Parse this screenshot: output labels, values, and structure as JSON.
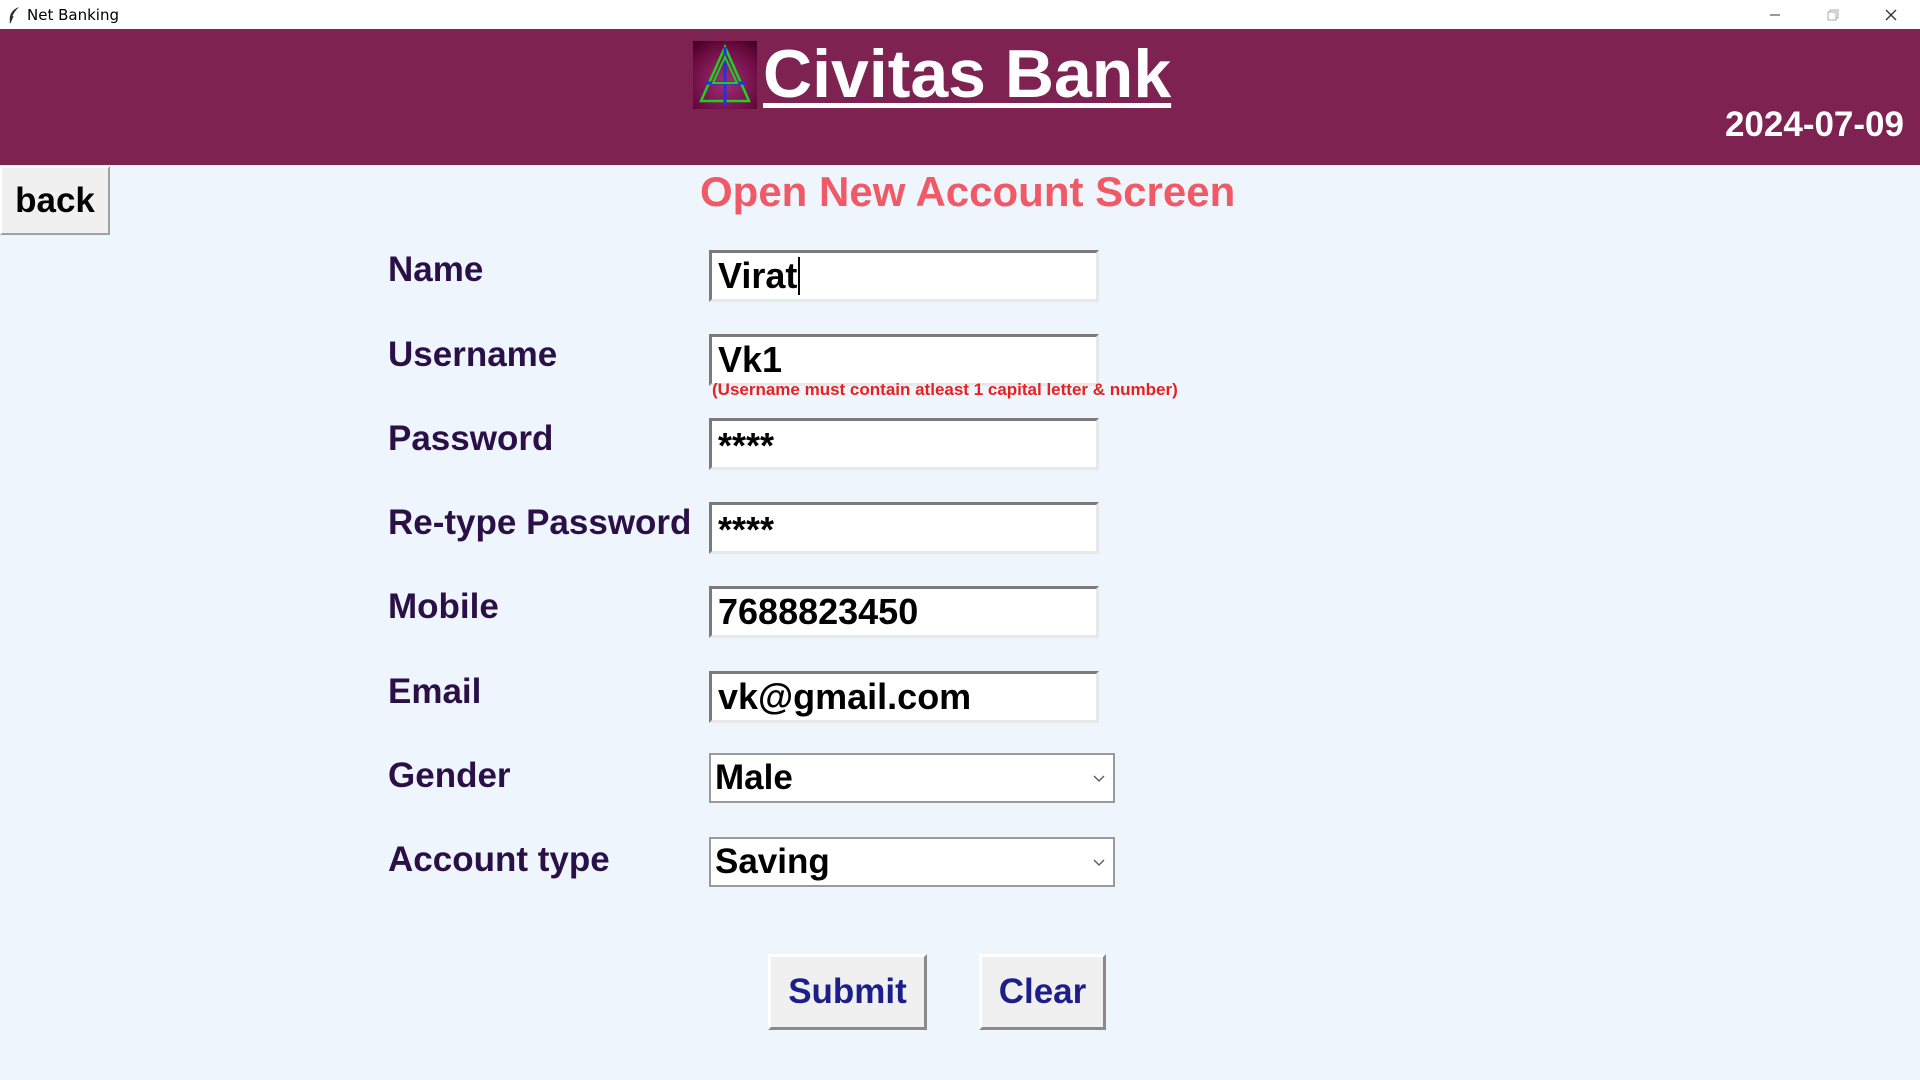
{
  "window": {
    "title": "Net Banking",
    "icons": {
      "app": "feather-icon",
      "minimize": "minimize-icon",
      "maximize": "maximize-icon",
      "close": "close-icon"
    }
  },
  "header": {
    "bank_name": "Civitas Bank",
    "date": "2024-07-09",
    "background": "#7e2351"
  },
  "nav": {
    "back_label": "back"
  },
  "screen_title": "Open New Account Screen",
  "form": {
    "name": {
      "label": "Name",
      "value": "Virat"
    },
    "username": {
      "label": "Username",
      "value": "Vk1",
      "hint": "(Username must contain atleast 1 capital letter & number)"
    },
    "password": {
      "label": "Password",
      "value": "****"
    },
    "retype_password": {
      "label": "Re-type Password",
      "value": "****"
    },
    "mobile": {
      "label": "Mobile",
      "value": "7688823450"
    },
    "email": {
      "label": "Email",
      "value": "vk@gmail.com"
    },
    "gender": {
      "label": "Gender",
      "value": "Male"
    },
    "account_type": {
      "label": "Account type",
      "value": "Saving"
    }
  },
  "actions": {
    "submit_label": "Submit",
    "clear_label": "Clear"
  },
  "colors": {
    "title_red": "#f05a66",
    "label_purple": "#2a1047",
    "button_text": "#1c1f8a",
    "hint_red": "#e82020",
    "page_bg": "#eef5fd"
  }
}
